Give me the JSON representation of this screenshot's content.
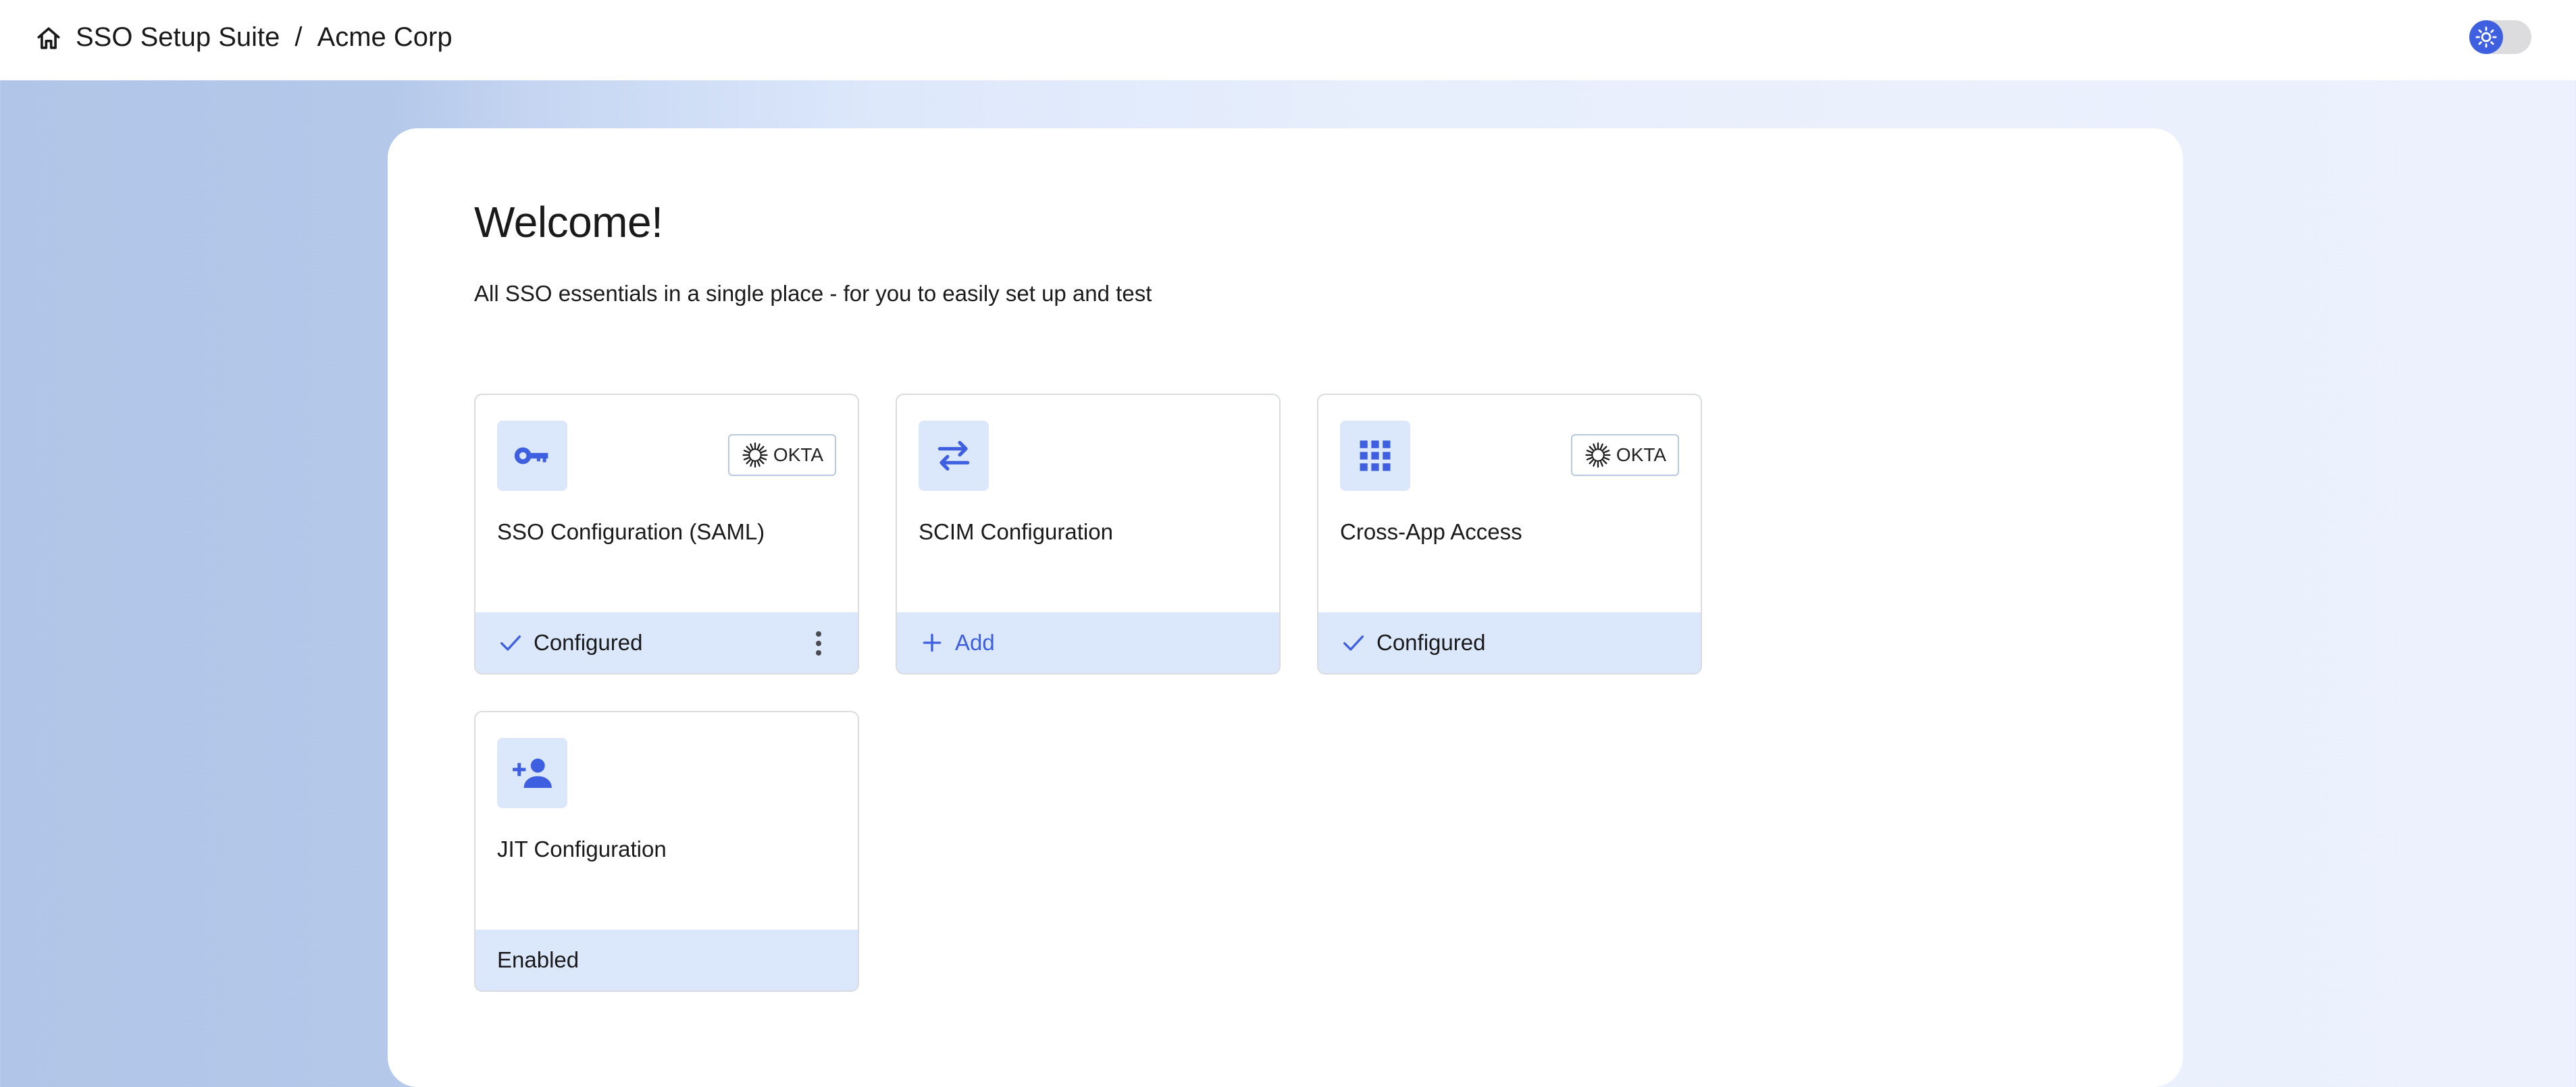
{
  "header": {
    "app_name": "SSO Setup Suite",
    "separator": "/",
    "org_name": "Acme Corp",
    "theme_toggle": {
      "state": "light",
      "icon": "sun-icon"
    }
  },
  "main": {
    "heading": "Welcome!",
    "subtitle": "All SSO essentials in a single place - for you to easily set up and test",
    "cards": [
      {
        "title": "SSO Configuration (SAML)",
        "icon": "key-icon",
        "provider_badge": "OKTA",
        "status": "Configured",
        "status_icon": "check-icon",
        "has_menu": true
      },
      {
        "title": "SCIM Configuration",
        "icon": "sync-arrows-icon",
        "status": "Add",
        "status_icon": "plus-icon"
      },
      {
        "title": "Cross-App Access",
        "icon": "app-grid-icon",
        "provider_badge": "OKTA",
        "status": "Configured",
        "status_icon": "check-icon"
      },
      {
        "title": "JIT Configuration",
        "icon": "add-user-icon",
        "status": "Enabled"
      }
    ]
  },
  "colors": {
    "accent": "#3d5fe0",
    "tile_bg": "#dbe7fb",
    "card_border": "#d9dbe1",
    "text": "#1a1a1a"
  }
}
